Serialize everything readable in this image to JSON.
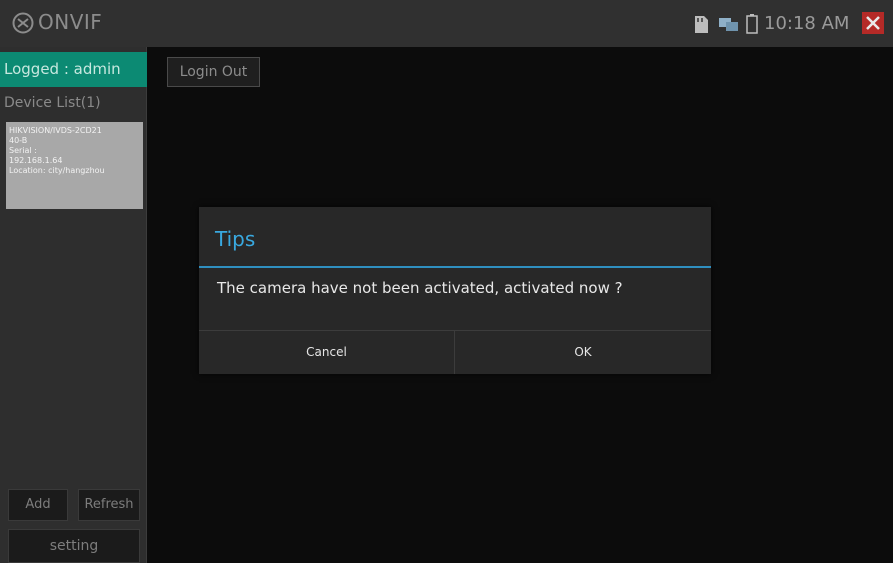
{
  "app": {
    "title": "ONVIF",
    "time": "10:18 AM"
  },
  "icons": {
    "logo": "camera-circle-icon",
    "sd": "sd-card-icon",
    "network": "network-icon",
    "battery": "battery-icon",
    "close": "close-icon"
  },
  "colors": {
    "accent_green": "#0c8a73",
    "dialog_title": "#39a9e0",
    "close_red": "#b52a27"
  },
  "sidebar": {
    "logged": "Logged : admin",
    "device_list_title": "Device List(1)",
    "device": {
      "line1": "HIKVISION/IVDS-2CD21",
      "line2": "40-B",
      "line3": "Serial :",
      "line4": "192.168.1.64",
      "line5": "Location: city/hangzhou"
    },
    "add_label": "Add",
    "refresh_label": "Refresh",
    "setting_label": "setting"
  },
  "main": {
    "logout_label": "Login Out"
  },
  "dialog": {
    "title": "Tips",
    "message": "The camera have not been activated, activated now ?",
    "cancel_label": "Cancel",
    "ok_label": "OK"
  }
}
